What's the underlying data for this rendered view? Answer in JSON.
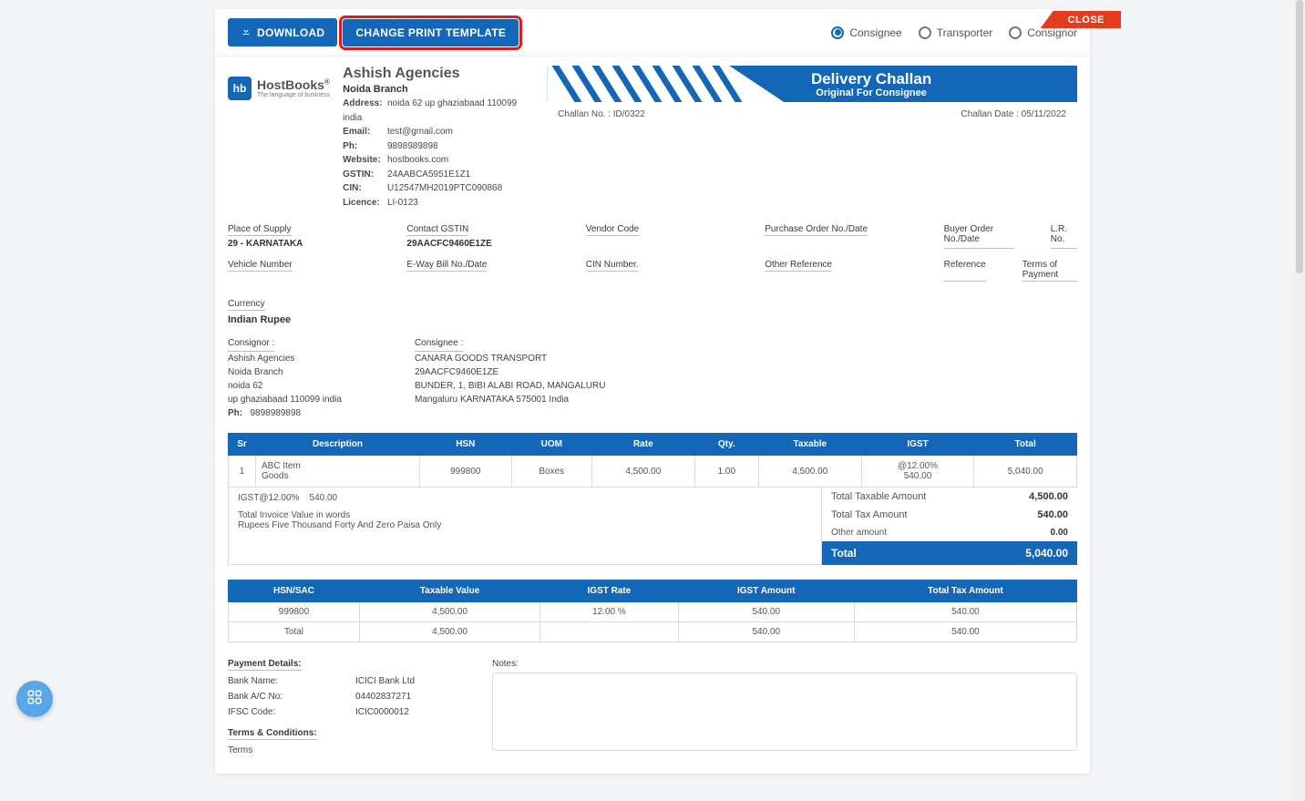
{
  "close_label": "CLOSE",
  "toolbar": {
    "download": "DOWNLOAD",
    "change_template": "CHANGE PRINT TEMPLATE"
  },
  "copy_options": [
    "Consignee",
    "Transporter",
    "Consignor"
  ],
  "logo": {
    "short": "hb",
    "name": "HostBooks",
    "tag": "The language of business",
    "reg": "®"
  },
  "company": {
    "name": "Ashish Agencies",
    "branch": "Noida Branch",
    "address_label": "Address:",
    "address": "noida 62 up ghaziabaad 110099 india",
    "email_label": "Email:",
    "email": "test@gmail.com",
    "ph_label": "Ph:",
    "phone": "9898989898",
    "web_label": "Website:",
    "web": "hostbooks.com",
    "gstin_label": "GSTIN:",
    "gstin": "24AABCA5951E1Z1",
    "cin_label": "CIN:",
    "cin": "U12547MH2019PTC090868",
    "lic_label": "Licence:",
    "lic": "LI-0123"
  },
  "banner": {
    "title": "Delivery Challan",
    "subtitle": "Original For Consignee"
  },
  "meta": {
    "challan_no": "Challan No. : ID/0322",
    "challan_date": "Challan Date : 05/11/2022"
  },
  "labels": {
    "pos": "Place of Supply",
    "pos_v": "29 - KARNATAKA",
    "c_gstin": "Contact GSTIN",
    "c_gstin_v": "29AACFC9460E1ZE",
    "vendor": "Vendor Code",
    "po": "Purchase Order No./Date",
    "buyer": "Buyer Order No./Date",
    "lr": "L.R. No.",
    "vehicle": "Vehicle Number",
    "eway": "E-Way Bill No./Date",
    "cinno": "CIN Number.",
    "otherref": "Other Reference",
    "ref": "Reference",
    "top": "Terms of Payment",
    "currency": "Currency",
    "currency_v": "Indian Rupee"
  },
  "consignor": {
    "label": "Consignor :",
    "lines": [
      "Ashish Agencies",
      "Noida Branch",
      "noida 62",
      "up ghaziabaad 110099 india"
    ],
    "ph_label": "Ph:",
    "ph": "9898989898"
  },
  "consignee": {
    "label": "Consignee :",
    "lines": [
      "CANARA GOODS TRANSPORT",
      "29AACFC9460E1ZE",
      "BUNDER, 1, BIBI ALABI ROAD, MANGALURU",
      "Mangaluru KARNATAKA 575001 India"
    ]
  },
  "table": {
    "headers": [
      "Sr",
      "Description",
      "HSN",
      "UOM",
      "Rate",
      "Qty.",
      "Taxable",
      "IGST",
      "Total"
    ],
    "row": {
      "sr": "1",
      "desc1": "ABC Item",
      "desc2": "Goods",
      "hsn": "999800",
      "uom": "Boxes",
      "rate": "4,500.00",
      "qty": "1.00",
      "taxable": "4,500.00",
      "igst1": "@12.00%",
      "igst2": "540.00",
      "total": "5,040.00"
    }
  },
  "summary": {
    "igst_line": "IGST@12.00%",
    "igst_amt": "540.00",
    "words_label": "Total Invoice Value in words",
    "words": "Rupees Five Thousand Forty And Zero Paisa Only",
    "lines": [
      {
        "lbl": "Total Taxable Amount",
        "amt": "4,500.00"
      },
      {
        "lbl": "Total Tax Amount",
        "amt": "540.00"
      },
      {
        "lbl": "Other amount",
        "amt": "0.00"
      }
    ],
    "total_lbl": "Total",
    "total_amt": "5,040.00"
  },
  "tax_table": {
    "headers": [
      "HSN/SAC",
      "Taxable Value",
      "IGST Rate",
      "IGST Amount",
      "Total Tax Amount"
    ],
    "rows": [
      [
        "999800",
        "4,500.00",
        "12.00 %",
        "540.00",
        "540.00"
      ],
      [
        "Total",
        "4,500.00",
        "",
        "540.00",
        "540.00"
      ]
    ]
  },
  "payment": {
    "title": "Payment Details:",
    "bank_name_l": "Bank Name:",
    "bank_name": "ICICI Bank Ltd",
    "acno_l": "Bank A/C No:",
    "acno": "04402837271",
    "ifsc_l": "IFSC Code:",
    "ifsc": "ICIC0000012"
  },
  "terms": {
    "title": "Terms & Conditions:",
    "body": "Terms"
  },
  "notes_label": "Notes:"
}
